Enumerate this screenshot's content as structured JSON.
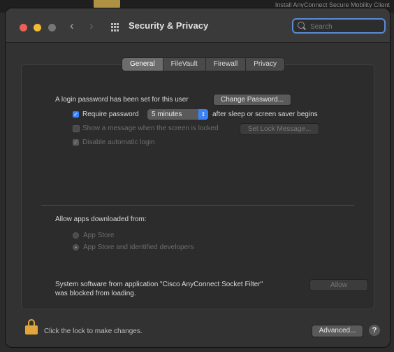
{
  "background": {
    "window_title": "Install AnyConnect Secure Mobility Client"
  },
  "window": {
    "title": "Security & Privacy",
    "nav_back": "‹",
    "nav_forward": "›"
  },
  "search": {
    "placeholder": "Search"
  },
  "tabs": [
    {
      "label": "General",
      "active": true
    },
    {
      "label": "FileVault",
      "active": false
    },
    {
      "label": "Firewall",
      "active": false
    },
    {
      "label": "Privacy",
      "active": false
    }
  ],
  "general": {
    "password_changed_text": "A login password has been set for this user",
    "change_password_label": "Change Password...",
    "require_password_label": "Require password",
    "require_password_checked": true,
    "require_password_value": "5 minutes",
    "after_sleep_text": "after sleep or screen saver begins",
    "show_message_label": "Show a message when the screen is locked",
    "show_message_checked": false,
    "set_message_label": "Set Lock Message...",
    "disable_autologin_label": "Disable automatic login",
    "disable_autologin_checked": true,
    "allow_apps_label": "Allow apps downloaded from:",
    "app_store_label": "App Store",
    "app_store_identified_label": "App Store and identified developers",
    "selected_source": "App Store and identified developers",
    "system_software_text_line1": "System software from application \"Cisco AnyConnect Socket Filter\"",
    "system_software_text_line2": "was blocked from loading.",
    "allow_label": "Allow"
  },
  "footer": {
    "lock_text": "Click the lock to make changes.",
    "advanced_label": "Advanced...",
    "help_label": "?"
  },
  "colors": {
    "accent": "#3a82f7",
    "close": "#ee5f57",
    "minimize": "#f3bc2f",
    "lock": "#e0a63c"
  },
  "icons": {
    "lock": "lock-icon",
    "search": "search-icon",
    "grid": "grid-icon"
  }
}
